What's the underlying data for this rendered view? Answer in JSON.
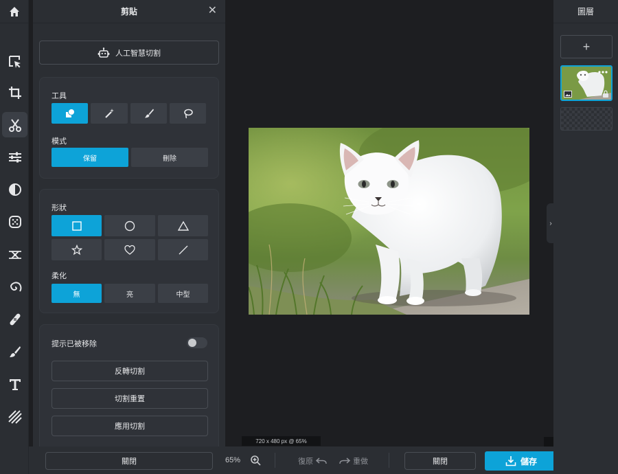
{
  "panel": {
    "title": "剪貼",
    "ai_button": "人工智慧切割",
    "tool_section": "工具",
    "mode_section": "模式",
    "mode_options": [
      "保留",
      "刪除"
    ],
    "shape_section": "形狀",
    "feather_section": "柔化",
    "feather_options": [
      "無",
      "亮",
      "中型"
    ],
    "hint_label": "提示已被移除",
    "invert_button": "反轉切割",
    "reset_button": "切割重置",
    "apply_button": "應用切割"
  },
  "bottom": {
    "close_label": "關閉",
    "zoom": "65%",
    "undo": "復原",
    "redo": "重做",
    "close2_label": "關閉",
    "save_label": "儲存"
  },
  "canvas": {
    "dimensions": "720 x 480 px @ 65%"
  },
  "layers": {
    "title": "圖層"
  },
  "colors": {
    "accent": "#0da3d8",
    "panel_bg": "#2b2e33",
    "canvas_bg": "#1d1e21"
  }
}
